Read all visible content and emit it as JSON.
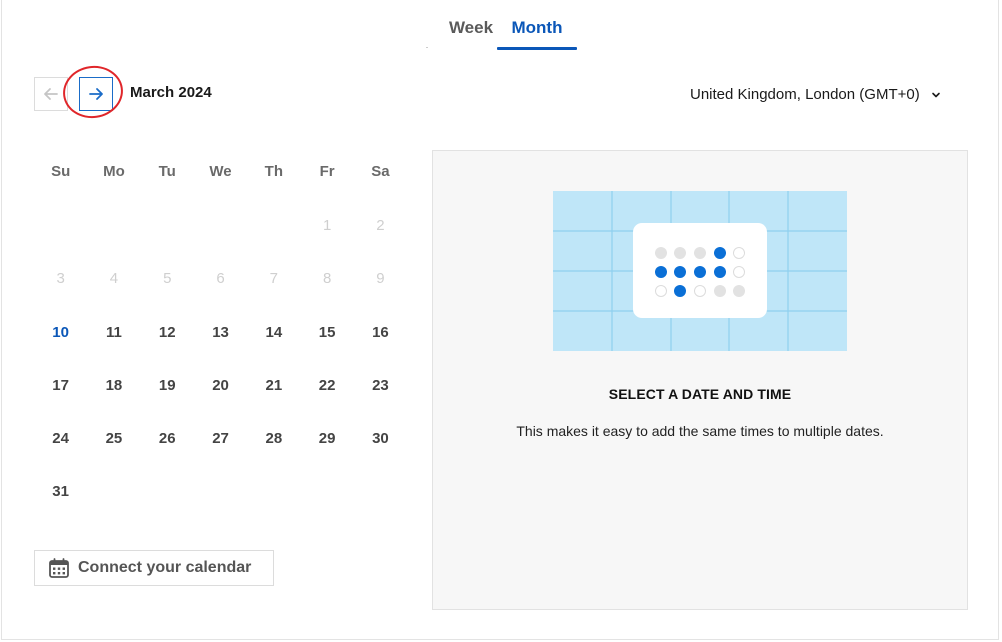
{
  "tabs": [
    {
      "label": "Week",
      "active": false
    },
    {
      "label": "Month",
      "active": true
    }
  ],
  "nav": {
    "month_label": "March 2024",
    "prev_icon": "arrow-left-icon",
    "next_icon": "arrow-right-icon"
  },
  "timezone": {
    "label": "United Kingdom, London (GMT+0)",
    "icon": "chevron-down-icon"
  },
  "calendar": {
    "weekdays": [
      "Su",
      "Mo",
      "Tu",
      "We",
      "Th",
      "Fr",
      "Sa"
    ],
    "weeks": [
      [
        "",
        "",
        "",
        "",
        "",
        "1",
        "2"
      ],
      [
        "3",
        "4",
        "5",
        "6",
        "7",
        "8",
        "9"
      ],
      [
        "10",
        "11",
        "12",
        "13",
        "14",
        "15",
        "16"
      ],
      [
        "17",
        "18",
        "19",
        "20",
        "21",
        "22",
        "23"
      ],
      [
        "24",
        "25",
        "26",
        "27",
        "28",
        "29",
        "30"
      ],
      [
        "31",
        "",
        "",
        "",
        "",
        "",
        ""
      ]
    ],
    "muted_days": [
      "1",
      "2",
      "3",
      "4",
      "5",
      "6",
      "7",
      "8",
      "9"
    ],
    "today": "10"
  },
  "connect": {
    "label": "Connect your calendar",
    "icon": "calendar-icon"
  },
  "panel": {
    "title": "SELECT A DATE AND TIME",
    "text": "This makes it easy to add the same times to multiple dates."
  },
  "colors": {
    "accent": "#0b57b8",
    "illustration_bg": "#bfe6f8",
    "dot_blue": "#0a6fd6",
    "dot_grey": "#e2e2e2",
    "annotation": "#e0262a"
  }
}
